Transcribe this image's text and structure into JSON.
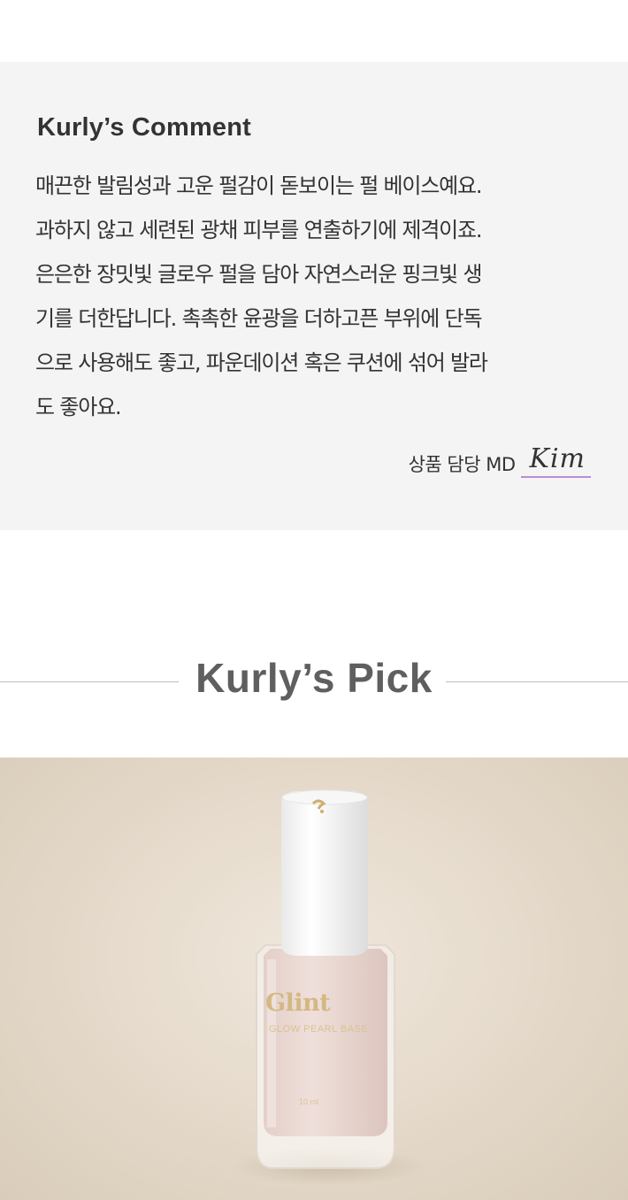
{
  "comment": {
    "title": "Kurly’s Comment",
    "lines": [
      "매끈한 발림성과 고운 펄감이 돋보이는 펄 베이스예요.",
      "과하지 않고 세련된 광채 피부를 연출하기에 제격이죠.",
      "은은한 장밋빛 글로우 펄을 담아 자연스러운 핑크빛 생",
      "기를 더한답니다. 촉촉한 윤광을 더하고픈 부위에 단독",
      "으로 사용해도 좋고, 파운데이션 혹은 쿠션에 섞어 발라",
      "도 좋아요."
    ],
    "signature_label": "상품 담당 MD",
    "signature_name": "Kim"
  },
  "pick": {
    "title": "Kurly’s Pick"
  },
  "product": {
    "brand": "Glint",
    "variant": "GLOW PEARL BASE",
    "volume": "10 ml"
  },
  "colors": {
    "comment_bg": "#f4f4f4",
    "text": "#333333",
    "signature_underline": "#b48fd6",
    "pick_title": "#5f5f5f",
    "divider": "#bdbdbd",
    "photo_bg": "#e6dbcc",
    "bottle_liquid": "#ecdad5",
    "cap": "#f7f7f7",
    "gold": "#d2b77f"
  }
}
